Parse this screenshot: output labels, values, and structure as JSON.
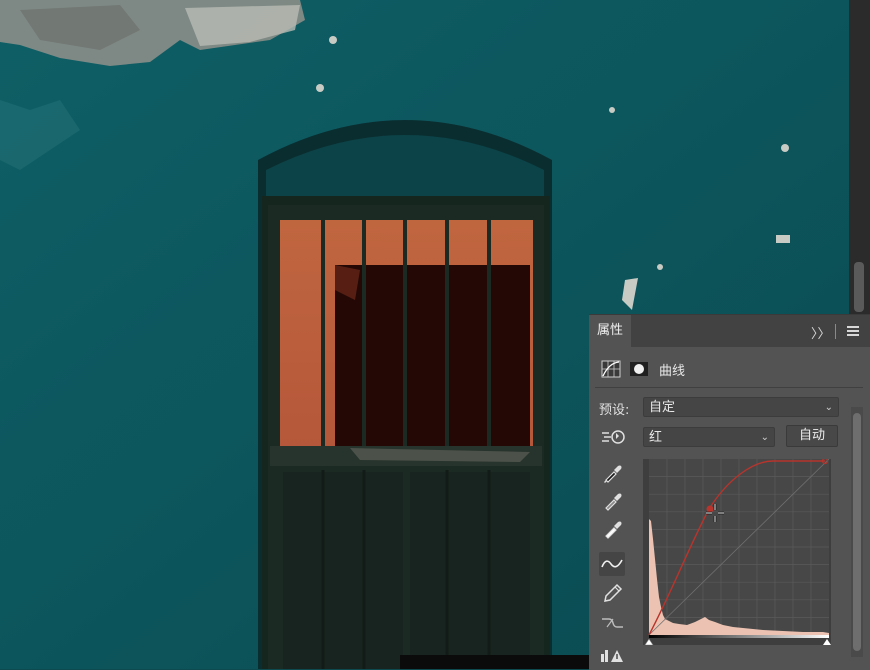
{
  "panel": {
    "tab_label": "属性",
    "collapse_glyph": "〉〉",
    "adjustment_title": "曲线",
    "preset_label": "预设:",
    "preset_value": "自定",
    "channel_value": "红",
    "auto_button": "自动",
    "chevron": "⌄"
  },
  "icons": [
    "curves-adjustment-icon",
    "layer-mask-icon",
    "on-image-adjust-icon",
    "black-point-eyedropper-icon",
    "gray-point-eyedropper-icon",
    "white-point-eyedropper-icon",
    "curve-point-tool-icon",
    "pencil-draw-icon",
    "smooth-curve-icon",
    "clipping-warning-icon"
  ],
  "colors": {
    "wall_teal": "#0f5f66",
    "curve_red": "#b8342c",
    "panel_bg": "#535353",
    "graph_bg": "#3e3e3e"
  }
}
